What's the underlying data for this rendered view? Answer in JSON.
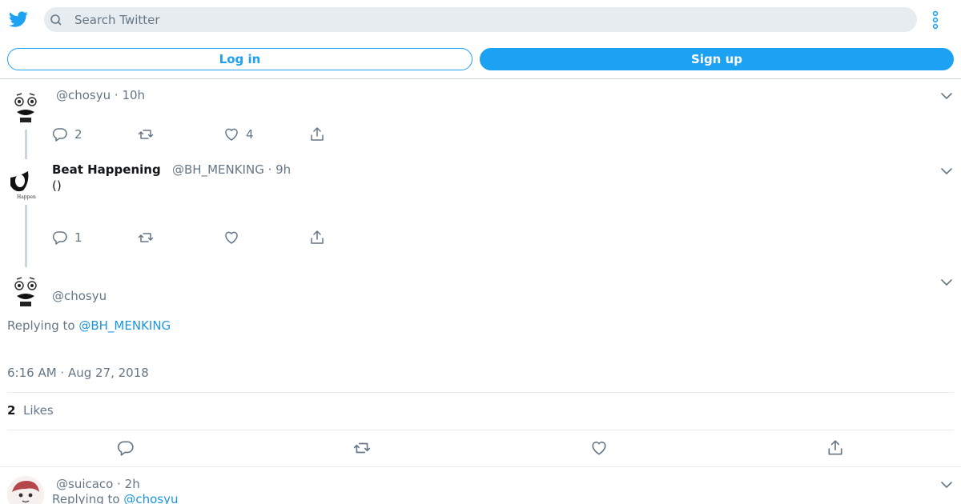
{
  "header": {
    "search_placeholder": "Search Twitter",
    "login_label": "Log in",
    "signup_label": "Sign up",
    "accent": "#1da1f2"
  },
  "tweets": [
    {
      "handle": "@chosyu",
      "time": "10h",
      "replies": "2",
      "retweets": "",
      "likes": "4",
      "avatar_icon": "face-avatar-icon"
    },
    {
      "name": "Beat Happening",
      "handle": "@BH_MENKING",
      "time": "9h",
      "text": "()",
      "replies": "1",
      "retweets": "",
      "likes": "",
      "avatar_icon": "band-avatar-icon"
    }
  ],
  "focused": {
    "handle": "@chosyu",
    "replying_prefix": "Replying to",
    "replying_to": "@BH_MENKING",
    "timestamp": "6:16 AM · Aug 27, 2018",
    "likes_count": "2",
    "likes_label": "Likes"
  },
  "reply": {
    "handle": "@suicaco",
    "time": "2h",
    "replying_prefix": "Replying to",
    "replying_to": "@chosyu",
    "avatar_icon": "anime-avatar-icon"
  },
  "separator": " · "
}
